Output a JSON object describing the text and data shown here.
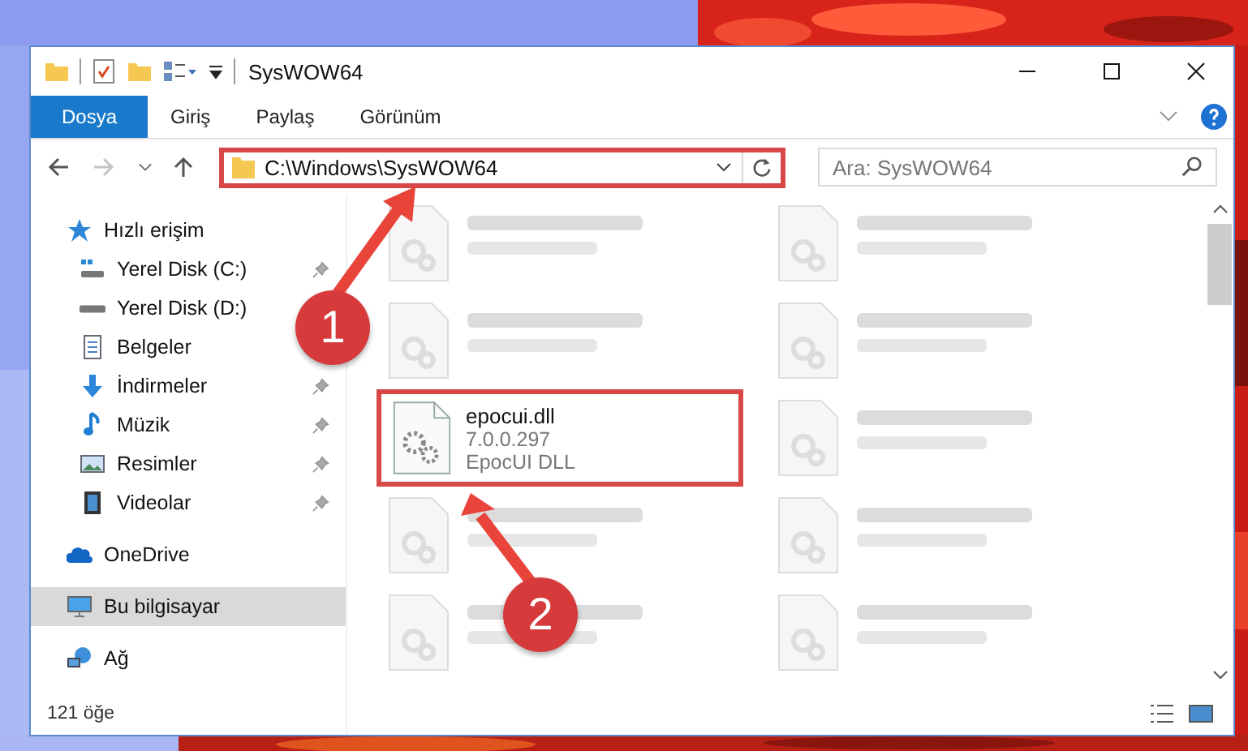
{
  "window": {
    "title": "SysWOW64"
  },
  "ribbon_tabs": [
    {
      "label": "Dosya",
      "selected": true
    },
    {
      "label": "Giriş",
      "selected": false
    },
    {
      "label": "Paylaş",
      "selected": false
    },
    {
      "label": "Görünüm",
      "selected": false
    }
  ],
  "address": {
    "path": "C:\\Windows\\SysWOW64",
    "highlighted": true
  },
  "search": {
    "placeholder": "Ara: SysWOW64"
  },
  "sidebar": {
    "items": [
      {
        "label": "Hızlı erişim",
        "kind": "star",
        "selected": false,
        "children": [
          {
            "label": "Yerel Disk (C:)",
            "kind": "system-drive",
            "pinned": true
          },
          {
            "label": "Yerel Disk (D:)",
            "kind": "drive",
            "pinned": false
          },
          {
            "label": "Belgeler",
            "kind": "documents",
            "pinned": false
          },
          {
            "label": "İndirmeler",
            "kind": "downloads",
            "pinned": true
          },
          {
            "label": "Müzik",
            "kind": "music",
            "pinned": true
          },
          {
            "label": "Resimler",
            "kind": "pictures",
            "pinned": true
          },
          {
            "label": "Videolar",
            "kind": "videos",
            "pinned": true
          }
        ]
      },
      {
        "label": "OneDrive",
        "kind": "cloud",
        "selected": false
      },
      {
        "label": "Bu bilgisayar",
        "kind": "computer",
        "selected": true
      },
      {
        "label": "Ağ",
        "kind": "network",
        "selected": false
      }
    ]
  },
  "files": [
    {
      "blurred": true,
      "highlighted": false
    },
    {
      "blurred": true,
      "highlighted": false
    },
    {
      "blurred": true,
      "highlighted": false
    },
    {
      "blurred": true,
      "highlighted": false
    },
    {
      "name": "epocui.dll",
      "details": [
        "7.0.0.297",
        "EpocUI DLL"
      ],
      "blurred": false,
      "highlighted": true
    },
    {
      "blurred": true,
      "highlighted": false
    },
    {
      "blurred": true,
      "highlighted": false
    },
    {
      "blurred": true,
      "highlighted": false
    },
    {
      "blurred": true,
      "highlighted": false
    },
    {
      "blurred": true,
      "highlighted": false
    }
  ],
  "callouts": [
    {
      "number": "1"
    },
    {
      "number": "2"
    }
  ],
  "status_bar": {
    "count": "121 öğe"
  }
}
